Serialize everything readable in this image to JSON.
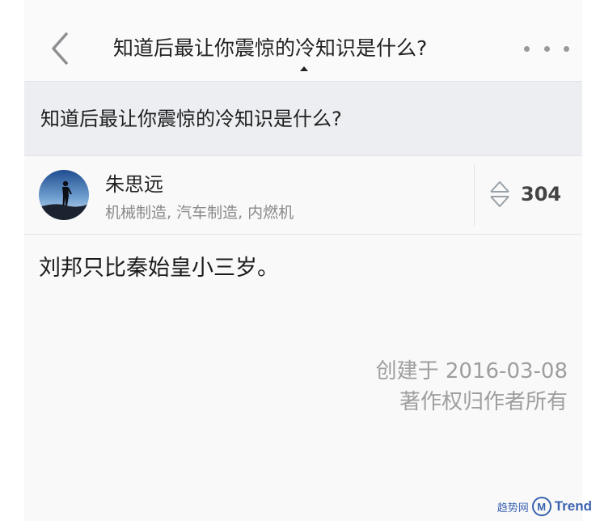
{
  "navbar": {
    "back_icon": "chevron-left-icon",
    "title": "知道后最让你震惊的冷知识是什么?",
    "more_icon": "more-dots-icon"
  },
  "question": {
    "title": "知道后最让你震惊的冷知识是什么?"
  },
  "author": {
    "name": "朱思远",
    "bio": "机械制造, 汽车制造, 内燃机",
    "avatar_icon": "avatar-silhouette"
  },
  "vote": {
    "icon": "vote-arrows-icon",
    "count": "304"
  },
  "answer": {
    "text": "刘邦只比秦始皇小三岁。"
  },
  "meta": {
    "created": "创建于 2016-03-08",
    "copyright": "著作权归作者所有"
  },
  "watermark": {
    "cn_text": "趋势网",
    "logo_letter": "M",
    "brand": "Trend"
  },
  "colors": {
    "header_bg": "#eceef2",
    "page_bg": "#f9f9f9",
    "meta_text": "#9e9e9e",
    "watermark_blue": "#3a62b0"
  }
}
